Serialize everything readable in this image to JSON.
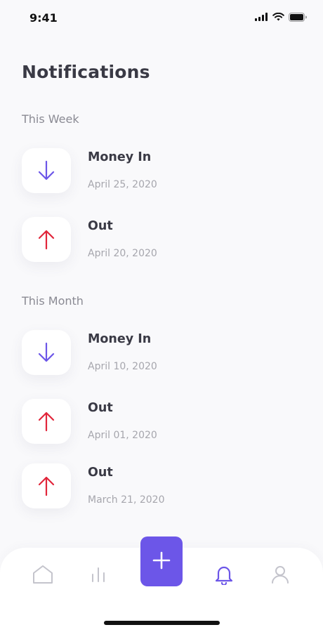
{
  "status_bar": {
    "time": "9:41"
  },
  "page": {
    "title": "Notifications"
  },
  "sections": [
    {
      "label": "This Week",
      "items": [
        {
          "title": "Money In",
          "date": "April 25, 2020",
          "direction": "down",
          "icon": "arrow-down-icon"
        },
        {
          "title": "Out",
          "date": "April 20, 2020",
          "direction": "up",
          "icon": "arrow-up-icon"
        }
      ]
    },
    {
      "label": "This Month",
      "items": [
        {
          "title": "Money In",
          "date": "April 10, 2020",
          "direction": "down",
          "icon": "arrow-down-icon"
        },
        {
          "title": "Out",
          "date": "April 01, 2020",
          "direction": "up",
          "icon": "arrow-up-icon"
        },
        {
          "title": "Out",
          "date": "March 21, 2020",
          "direction": "up",
          "icon": "arrow-up-icon"
        }
      ]
    }
  ],
  "bottom_nav": {
    "items": [
      {
        "icon": "home-icon",
        "active": false
      },
      {
        "icon": "stats-icon",
        "active": false
      },
      {
        "icon": "add-icon",
        "active": false
      },
      {
        "icon": "bell-icon",
        "active": true
      },
      {
        "icon": "profile-icon",
        "active": false
      }
    ]
  },
  "colors": {
    "accent": "#6c56e8",
    "money_in": "#6c56e8",
    "money_out": "#e1253a",
    "inactive_icon": "#c4c4cc",
    "background": "#f9f9fb"
  }
}
